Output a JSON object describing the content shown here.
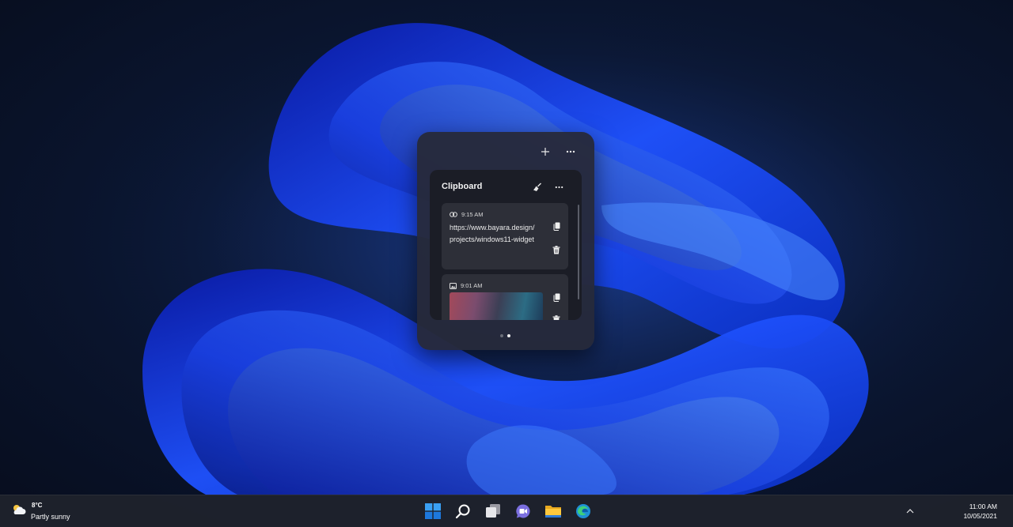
{
  "widget_board": {
    "add_icon": "plus-icon",
    "more_icon": "more-horizontal-icon",
    "clipboard": {
      "title": "Clipboard",
      "clear_icon": "broom-icon",
      "more_icon": "more-horizontal-icon",
      "items": [
        {
          "type_icon": "link-icon",
          "time": "9:15 AM",
          "text_line1": "https://www.bayara.design/",
          "text_line2": "projects/windows11-widget"
        },
        {
          "type_icon": "image-icon",
          "time": "9:01 AM"
        }
      ],
      "copy_icon": "copy-icon",
      "delete_icon": "trash-icon"
    },
    "pager": {
      "count": 2,
      "active": 2
    }
  },
  "taskbar": {
    "weather": {
      "temperature": "8°C",
      "condition": "Partly sunny",
      "icon": "partly-sunny-icon"
    },
    "apps": [
      "windows-start-icon",
      "search-icon",
      "task-view-icon",
      "teams-chat-icon",
      "file-explorer-icon",
      "edge-icon"
    ],
    "clock": {
      "time": "11:00 AM",
      "date": "10/05/2021"
    }
  },
  "colors": {
    "accent_blue": "#1c6cf0",
    "widget_bg": "#262a3a",
    "clipboard_bg": "#1b1d26",
    "item_bg": "#2d2f38"
  }
}
